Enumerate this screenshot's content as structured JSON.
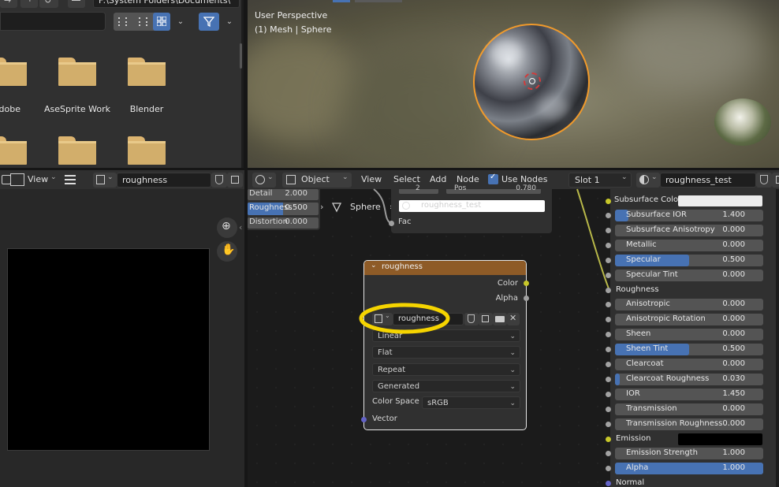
{
  "file_browser": {
    "path": "F:\\System Folders\\Documents\\",
    "folders": [
      {
        "label": "Adobe"
      },
      {
        "label": "AseSprite Work"
      },
      {
        "label": "Blender"
      },
      {
        "label": ""
      },
      {
        "label": ""
      },
      {
        "label": ""
      }
    ]
  },
  "viewport": {
    "perspective": "User Perspective",
    "object_info": "(1) Mesh | Sphere"
  },
  "image_editor": {
    "view_menu": "View",
    "image_name": "roughness"
  },
  "node_editor": {
    "mode": "Object",
    "menus": [
      "View",
      "Select",
      "Add",
      "Node"
    ],
    "use_nodes_label": "Use Nodes",
    "slot": "Slot 1",
    "material": "roughness_test",
    "noise_node": {
      "detail_label": "Detail",
      "detail_value": "2.000",
      "roughness_label": "Roughness",
      "roughness_value": "0.500",
      "distortion_label": "Distortion",
      "distortion_value": "0.000",
      "sphere_label": "Sphere"
    },
    "ramp_node": {
      "stop_index": "2",
      "pos_label": "Pos",
      "pos_value": "0.780",
      "image_text": "roughness_test",
      "fac_label": "Fac"
    },
    "image_node": {
      "title": "roughness",
      "color_out": "Color",
      "alpha_out": "Alpha",
      "image_name": "roughness",
      "interpolation": "Linear",
      "projection": "Flat",
      "extension": "Repeat",
      "source": "Generated",
      "color_space_label": "Color Space",
      "color_space": "sRGB",
      "vector_in": "Vector"
    },
    "bsdf": {
      "subsurface_color_label": "Subsurface Color",
      "rows": [
        {
          "label": "Subsurface IOR",
          "value": "1.400",
          "fill": 0.09
        },
        {
          "label": "Subsurface Anisotropy",
          "value": "0.000",
          "fill": 0
        },
        {
          "label": "Metallic",
          "value": "0.000",
          "fill": 0
        },
        {
          "label": "Specular",
          "value": "0.500",
          "fill": 0.5
        },
        {
          "label": "Specular Tint",
          "value": "0.000",
          "fill": 0
        },
        {
          "label": "Roughness",
          "value": "",
          "fill": 0
        },
        {
          "label": "Anisotropic",
          "value": "0.000",
          "fill": 0
        },
        {
          "label": "Anisotropic Rotation",
          "value": "0.000",
          "fill": 0
        },
        {
          "label": "Sheen",
          "value": "0.000",
          "fill": 0
        },
        {
          "label": "Sheen Tint",
          "value": "0.500",
          "fill": 0.5
        },
        {
          "label": "Clearcoat",
          "value": "0.000",
          "fill": 0
        },
        {
          "label": "Clearcoat Roughness",
          "value": "0.030",
          "fill": 0.03
        },
        {
          "label": "IOR",
          "value": "1.450",
          "fill": 0
        },
        {
          "label": "Transmission",
          "value": "0.000",
          "fill": 0
        },
        {
          "label": "Transmission Roughness",
          "value": "0.000",
          "fill": 0
        },
        {
          "label": "Emission",
          "value": "",
          "fill": 0
        },
        {
          "label": "Emission Strength",
          "value": "1.000",
          "fill": 0
        },
        {
          "label": "Alpha",
          "value": "1.000",
          "fill": 1
        },
        {
          "label": "Normal",
          "value": "",
          "fill": 0
        }
      ]
    }
  },
  "colors": {
    "accent_blue": "#4772b3",
    "image_node_header": "#8e5b27",
    "highlight_circle": "#f5d400",
    "selection_outline": "#f19a2b"
  }
}
